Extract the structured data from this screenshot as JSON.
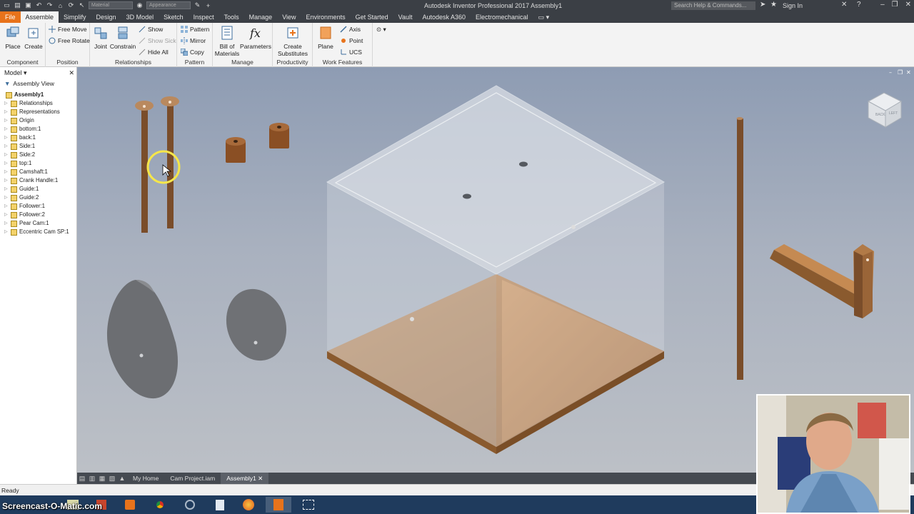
{
  "window": {
    "title": "Autodesk Inventor Professional 2017    Assembly1",
    "search_placeholder": "Search Help & Commands...",
    "sign_in": "Sign In",
    "material_select": "Material",
    "appearance_select": "Appearance"
  },
  "tabs": [
    "File",
    "Assemble",
    "Simplify",
    "Design",
    "3D Model",
    "Sketch",
    "Inspect",
    "Tools",
    "Manage",
    "View",
    "Environments",
    "Get Started",
    "Vault",
    "Autodesk A360",
    "Electromechanical"
  ],
  "active_tab": "Assemble",
  "ribbon": {
    "component": {
      "label": "Component",
      "place": "Place",
      "create": "Create"
    },
    "position": {
      "label": "Position",
      "free_move": "Free Move",
      "free_rotate": "Free Rotate"
    },
    "relationships": {
      "label": "Relationships",
      "joint": "Joint",
      "constrain": "Constrain",
      "show": "Show",
      "show_sick": "Show Sick",
      "hide_all": "Hide All"
    },
    "pattern": {
      "label": "Pattern",
      "pattern": "Pattern",
      "mirror": "Mirror",
      "copy": "Copy"
    },
    "manage": {
      "label": "Manage",
      "bom_line1": "Bill of",
      "bom_line2": "Materials",
      "parameters": "Parameters"
    },
    "productivity": {
      "label": "Productivity",
      "create_sub_line1": "Create",
      "create_sub_line2": "Substitutes"
    },
    "work_features": {
      "label": "Work Features",
      "plane": "Plane",
      "axis": "Axis",
      "point": "Point",
      "ucs": "UCS"
    }
  },
  "browser": {
    "title": "Model",
    "view": "Assembly View",
    "root": "Assembly1",
    "items": [
      "Relationships",
      "Representations",
      "Origin",
      "bottom:1",
      "back:1",
      "Side:1",
      "Side:2",
      "top:1",
      "Camshaft:1",
      "Crank Handle:1",
      "Guide:1",
      "Guide:2",
      "Follower:1",
      "Follower:2",
      "Pear Cam:1",
      "Eccentric Cam SP:1"
    ]
  },
  "viewcube": {
    "left": "LEFT",
    "back": "BACK"
  },
  "doc_tabs": [
    "My Home",
    "Cam Project.iam",
    "Assembly1"
  ],
  "active_doc": "Assembly1",
  "status": "Ready",
  "watermark": "Screencast-O-Matic.com",
  "colors": {
    "file_tab": "#e8731b",
    "wood": "#b07a4a",
    "cam_gray": "#6b6d70",
    "ribbon_bg": "#f3f3f3"
  }
}
